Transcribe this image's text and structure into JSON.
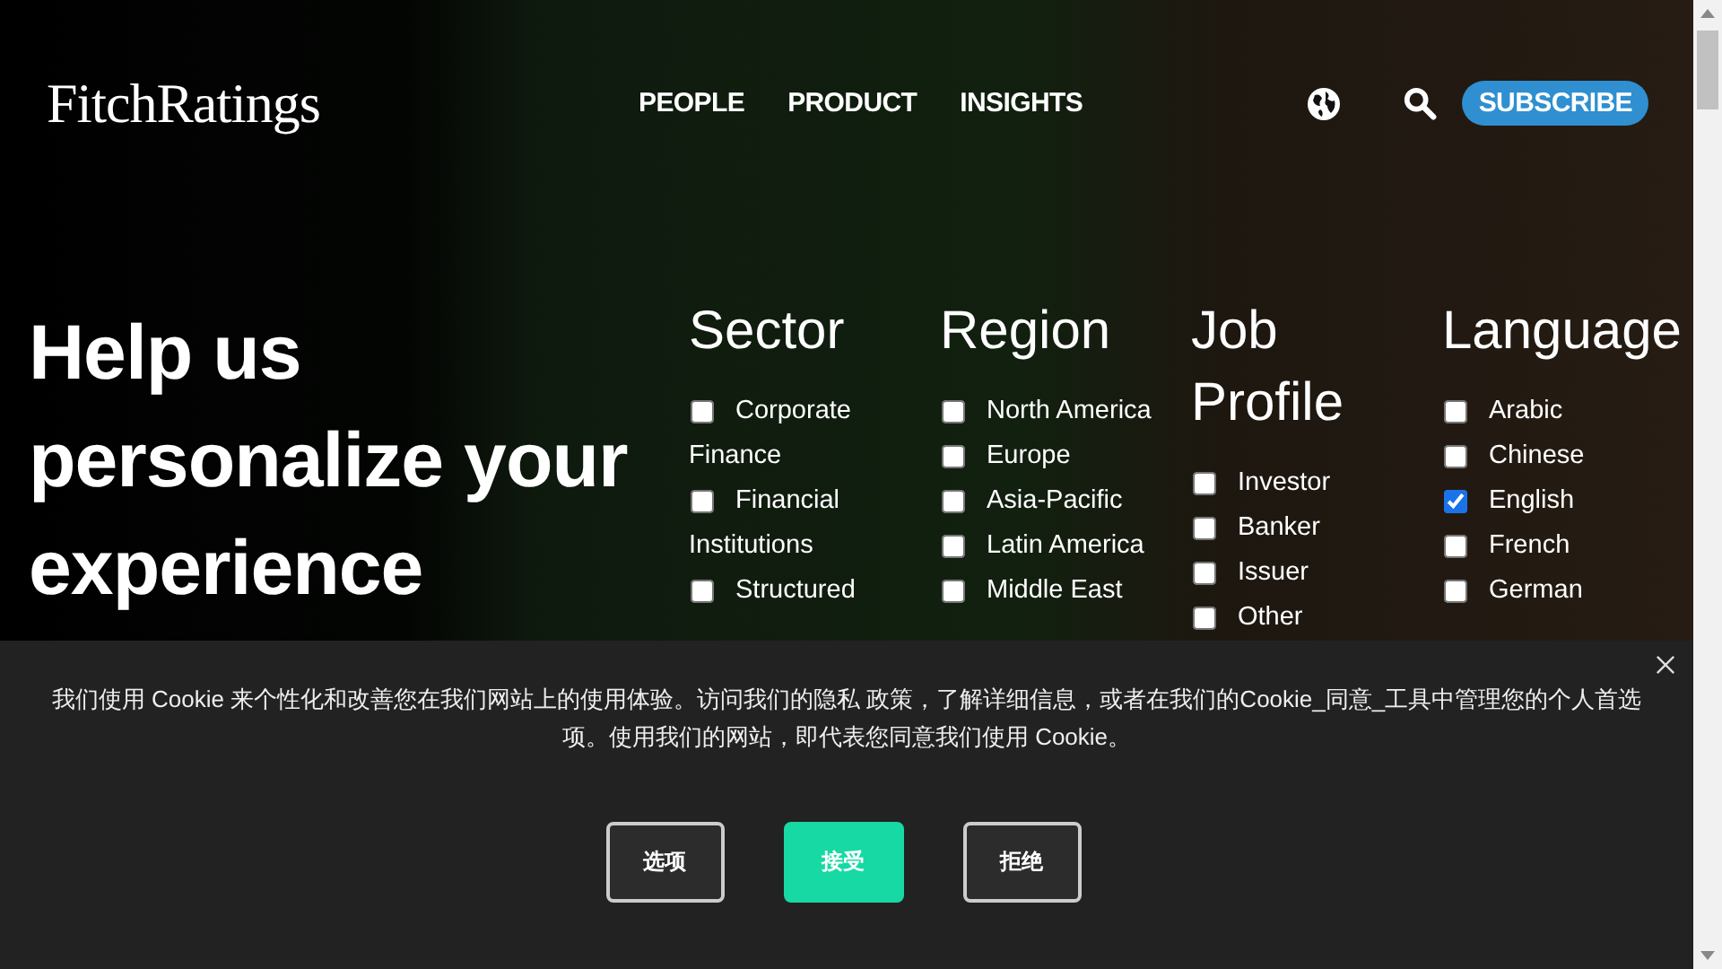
{
  "header": {
    "logo": "FitchRatings",
    "nav": [
      "PEOPLE",
      "PRODUCT",
      "INSIGHTS"
    ],
    "subscribe": "SUBSCRIBE"
  },
  "hero": {
    "title": "Help us personalize your experience"
  },
  "filters": [
    {
      "heading": "Sector",
      "options": [
        {
          "label": "Corporate Finance",
          "checked": false
        },
        {
          "label": "Financial Institutions",
          "checked": false
        },
        {
          "label": "Structured",
          "checked": false
        }
      ]
    },
    {
      "heading": "Region",
      "options": [
        {
          "label": "North America",
          "checked": false
        },
        {
          "label": "Europe",
          "checked": false
        },
        {
          "label": "Asia-Pacific",
          "checked": false
        },
        {
          "label": "Latin America",
          "checked": false
        },
        {
          "label": "Middle East",
          "checked": false
        }
      ]
    },
    {
      "heading": "Job Profile",
      "options": [
        {
          "label": "Investor",
          "checked": false
        },
        {
          "label": "Banker",
          "checked": false
        },
        {
          "label": "Issuer",
          "checked": false
        },
        {
          "label": "Other",
          "checked": false
        }
      ]
    },
    {
      "heading": "Language",
      "options": [
        {
          "label": "Arabic",
          "checked": false
        },
        {
          "label": "Chinese",
          "checked": false
        },
        {
          "label": "English",
          "checked": true
        },
        {
          "label": "French",
          "checked": false
        },
        {
          "label": "German",
          "checked": false
        }
      ]
    }
  ],
  "cookie_banner": {
    "text": "我们使用 Cookie 来个性化和改善您在我们网站上的使用体验。访问我们的隐私 政策，了解详细信息，或者在我们的Cookie_同意_工具中管理您的个人首选项。使用我们的网站，即代表您同意我们使用 Cookie。",
    "buttons": [
      {
        "label": "选项",
        "kind": "outline"
      },
      {
        "label": "接受",
        "kind": "primary"
      },
      {
        "label": "拒绝",
        "kind": "outline"
      }
    ]
  }
}
